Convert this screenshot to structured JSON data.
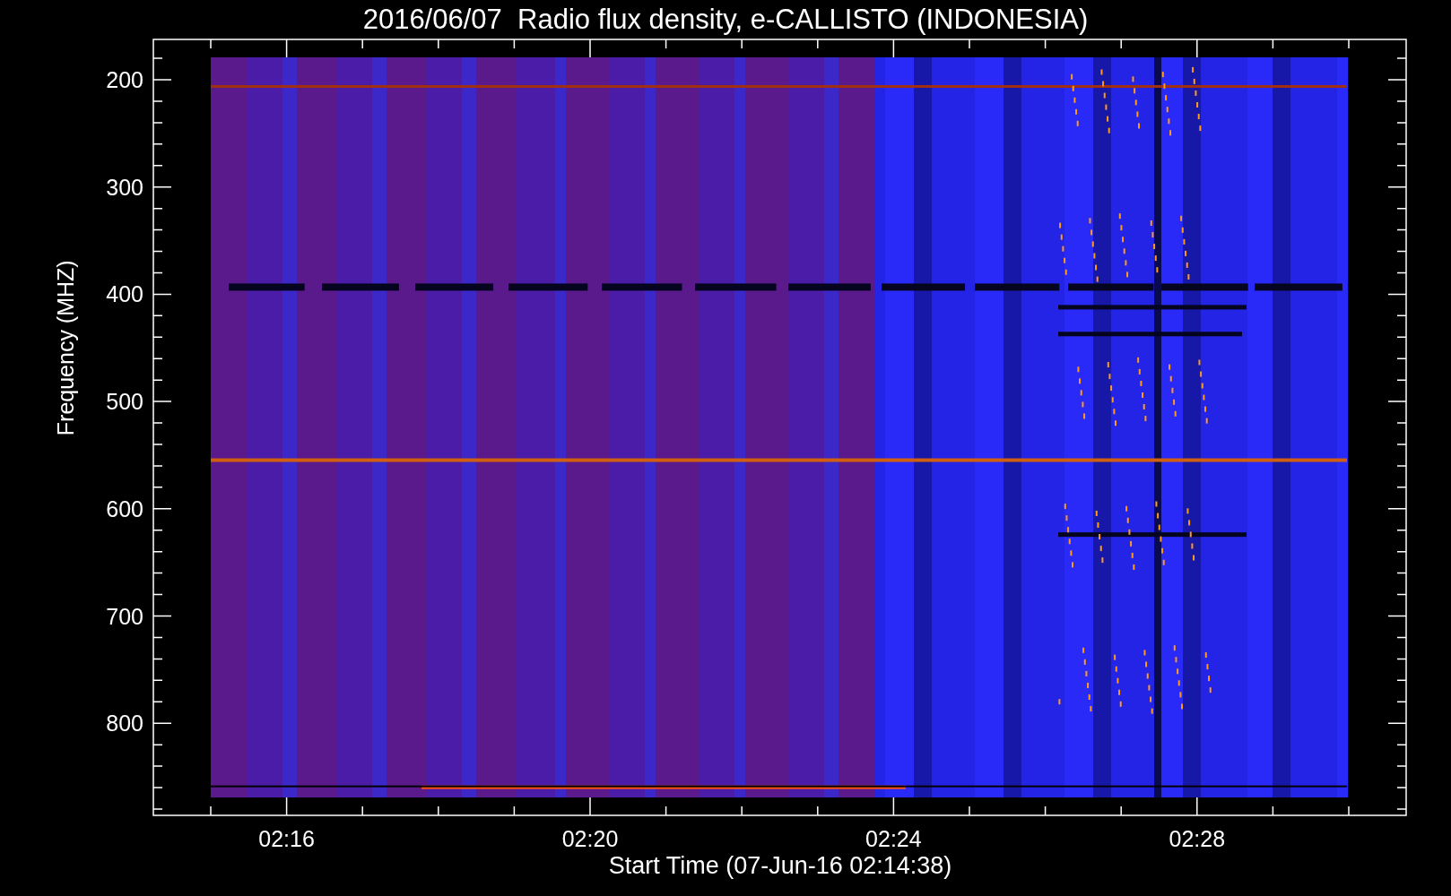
{
  "title": "2016/06/07  Radio flux density, e-CALLISTO (INDONESIA)",
  "y_axis": {
    "label": "Frequency (MHZ)",
    "ticks": [
      "200",
      "300",
      "400",
      "500",
      "600",
      "700",
      "800"
    ]
  },
  "x_axis": {
    "label": "Start Time (07-Jun-16 02:14:38)",
    "ticks": [
      "02:16",
      "02:20",
      "02:24",
      "02:28"
    ]
  }
}
